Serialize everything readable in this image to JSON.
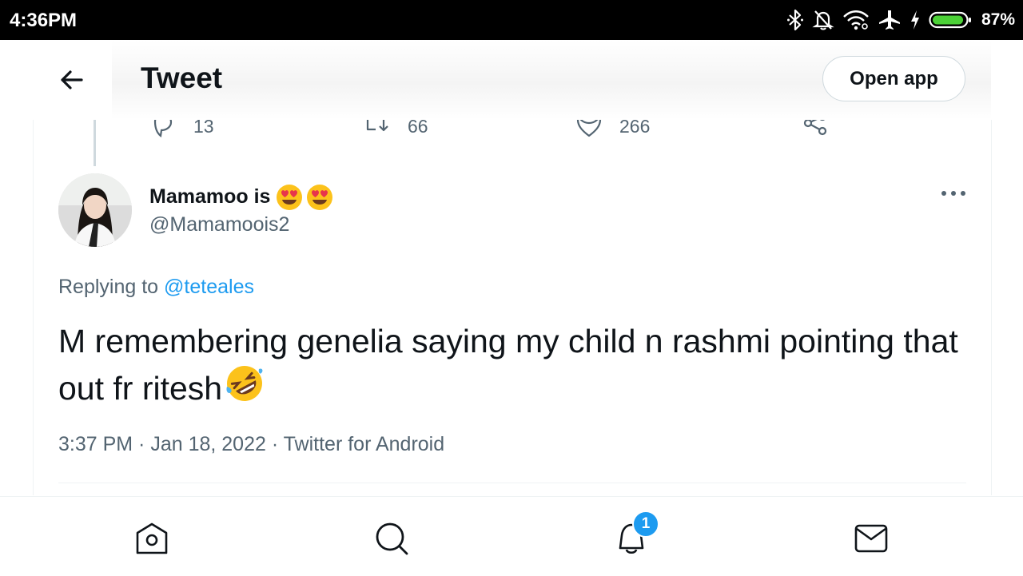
{
  "status_bar": {
    "time": "4:36PM",
    "battery": "87%",
    "icons": [
      "bluetooth-icon",
      "bell-off-icon",
      "wifi-icon",
      "airplane-icon",
      "charging-icon",
      "battery-icon"
    ]
  },
  "header": {
    "title": "Tweet",
    "open_app_label": "Open app"
  },
  "prev_tweet_actions": {
    "replies": "13",
    "retweets": "66",
    "likes": "266"
  },
  "tweet": {
    "author_name": "Mamamoo is",
    "author_emoji": "heart-eyes-emoji",
    "author_handle": "@Mamamoois2",
    "replying_prefix": "Replying to",
    "replying_to": "@teteales",
    "text": "M remembering genelia saying my child n rashmi pointing that out fr ritesh",
    "text_emoji": "rofl-emoji",
    "meta": "3:37 PM · Jan 18, 2022 · Twitter for Android"
  },
  "bottom_nav": {
    "items": [
      "home-icon",
      "search-icon",
      "notifications-icon",
      "messages-icon"
    ],
    "notification_badge": "1"
  },
  "colors": {
    "accent": "#1d9bf0",
    "text_primary": "#0f1419",
    "text_secondary": "#536471",
    "border": "#cfd9de"
  }
}
